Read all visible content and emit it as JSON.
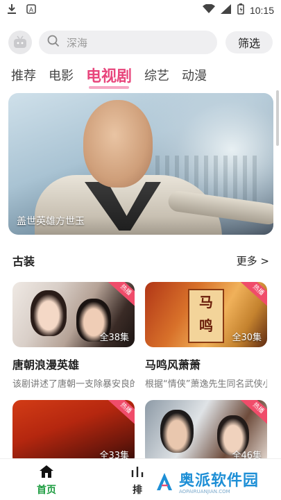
{
  "status_bar": {
    "time": "10:15",
    "icons": [
      "download-icon",
      "text-a-icon",
      "wifi-icon",
      "signal-icon",
      "battery-icon"
    ]
  },
  "header": {
    "search_placeholder": "深海",
    "filter_label": "筛选"
  },
  "tabs": [
    {
      "label": "推荐",
      "active": false
    },
    {
      "label": "电影",
      "active": false
    },
    {
      "label": "电视剧",
      "active": true
    },
    {
      "label": "综艺",
      "active": false
    },
    {
      "label": "动漫",
      "active": false
    }
  ],
  "banner": {
    "caption": "盖世英雄方世玉"
  },
  "section": {
    "title": "古装",
    "more_label": "更多 >"
  },
  "cards": [
    {
      "name": "唐朝浪漫英雄",
      "desc": "该剧讲述了唐朝一支除暴安良的",
      "episodes": "全38集",
      "badge": "热播"
    },
    {
      "name": "马鸣风萧萧",
      "desc": "根据“情侠”萧逸先生同名武侠小说",
      "episodes": "全30集",
      "badge": "热播",
      "poster_text": [
        "马",
        "鸣"
      ]
    },
    {
      "name": "",
      "desc": "",
      "episodes": "全33集",
      "badge": "热播"
    },
    {
      "name": "",
      "desc": "",
      "episodes": "全46集",
      "badge": "热播"
    }
  ],
  "bottom_nav": {
    "home_label": "首页",
    "rank_label": "排"
  },
  "watermark": {
    "brand": "奥派软件园",
    "url": "AOPAIRUANJIAN.COM"
  },
  "colors": {
    "accent": "#e8457c",
    "active_nav": "#1a9b3e",
    "badge": "#f04c6a"
  }
}
